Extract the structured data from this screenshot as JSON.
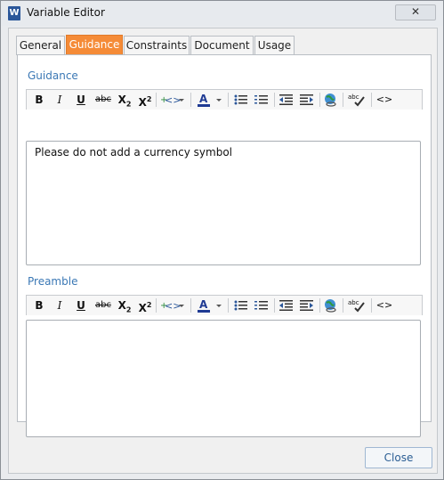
{
  "window": {
    "title": "Variable Editor",
    "app_icon_letter": "W",
    "close_glyph": "✕"
  },
  "tabs": [
    {
      "label": "General",
      "active": false
    },
    {
      "label": "Guidance",
      "active": true
    },
    {
      "label": "Constraints",
      "active": false
    },
    {
      "label": "Document",
      "active": false
    },
    {
      "label": "Usage",
      "active": false
    }
  ],
  "guidance": {
    "label": "Guidance",
    "text": "Please do not add a currency symbol"
  },
  "preamble": {
    "label": "Preamble",
    "text": ""
  },
  "toolbar": {
    "bold": "B",
    "italic": "I",
    "underline": "U",
    "strike": "abc",
    "subscript": "X",
    "subscript_mark": "2",
    "superscript": "X",
    "superscript_mark": "2",
    "insert_field": "<>",
    "font_color": "A",
    "dropdown": "▾",
    "spellcheck": "abc",
    "source": "<>"
  },
  "footer": {
    "close_label": "Close"
  },
  "colors": {
    "active_tab": "#f58b37",
    "section_label": "#3b78b5",
    "font_color_bar": "#1f3a93"
  }
}
